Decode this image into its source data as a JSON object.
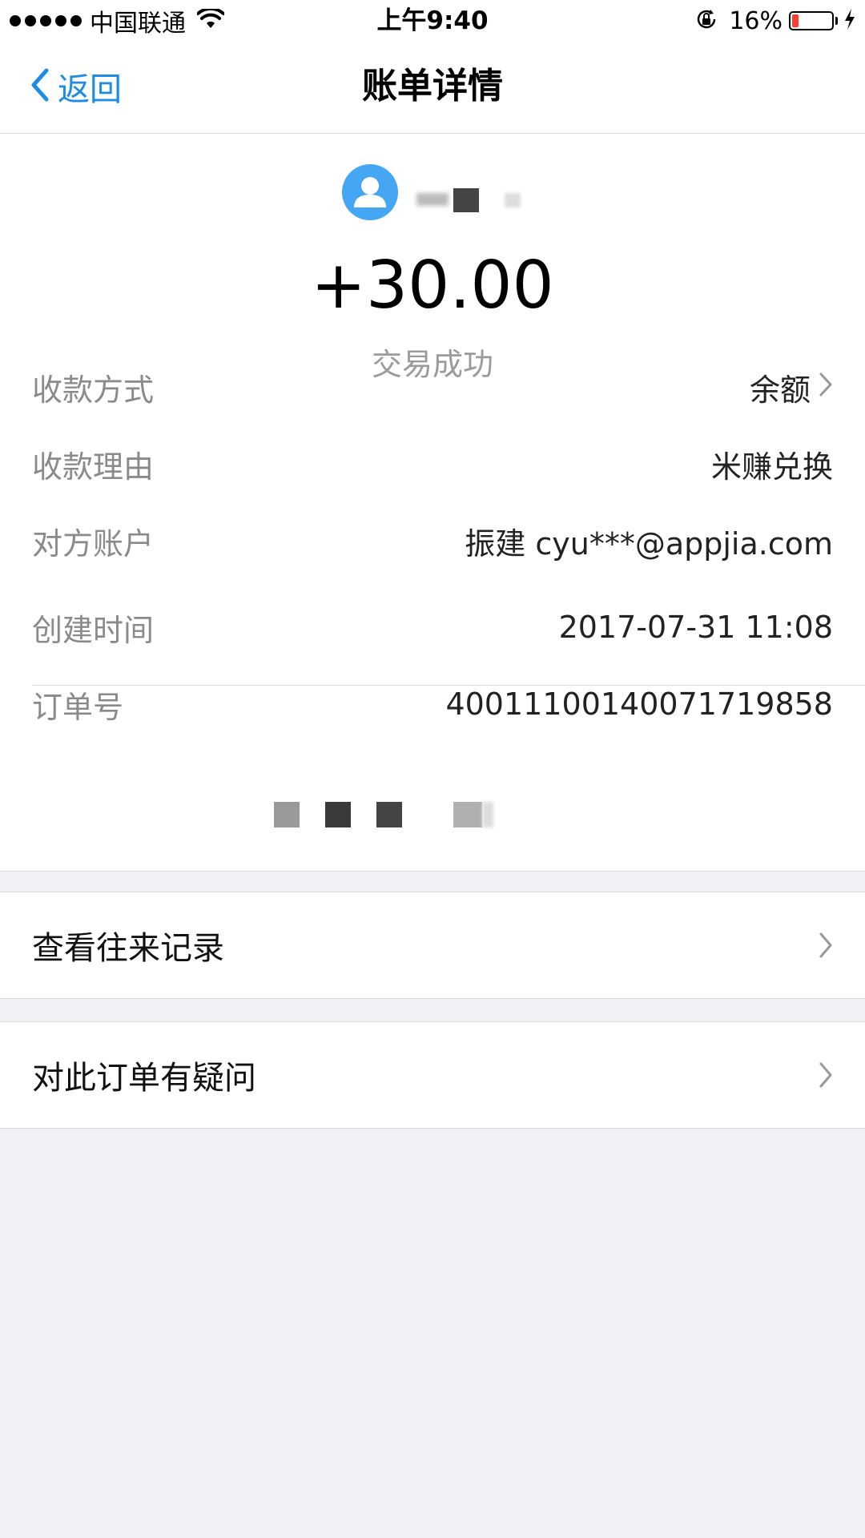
{
  "status_bar": {
    "carrier": "中国联通",
    "time": "上午9:40",
    "battery_percent": "16%",
    "battery_level": 0.16
  },
  "nav": {
    "back_label": "返回",
    "title": "账单详情"
  },
  "summary": {
    "amount": "+30.00",
    "status": "交易成功"
  },
  "details": {
    "payment_method": {
      "label": "收款方式",
      "value": "余额"
    },
    "reason": {
      "label": "收款理由",
      "value": "米赚兑换"
    },
    "counterparty": {
      "label": "对方账户",
      "value": "振建 cyu***@appjia.com"
    },
    "created_time": {
      "label": "创建时间",
      "value": "2017-07-31 11:08"
    },
    "order_no": {
      "label": "订单号",
      "value": "4001110014007171985​8"
    }
  },
  "actions": {
    "history": "查看往来记录",
    "dispute": "对此订单有疑问"
  },
  "colors": {
    "accent": "#1c8ce4",
    "avatar": "#45a6f3",
    "background": "#f0f0f5",
    "battery_low": "#ff3b30"
  },
  "icons": {
    "back": "chevron-left-icon",
    "avatar": "user-icon",
    "row_chevron": "chevron-right-icon",
    "wifi": "wifi-icon",
    "lock": "rotation-lock-icon",
    "charging": "bolt-icon"
  }
}
